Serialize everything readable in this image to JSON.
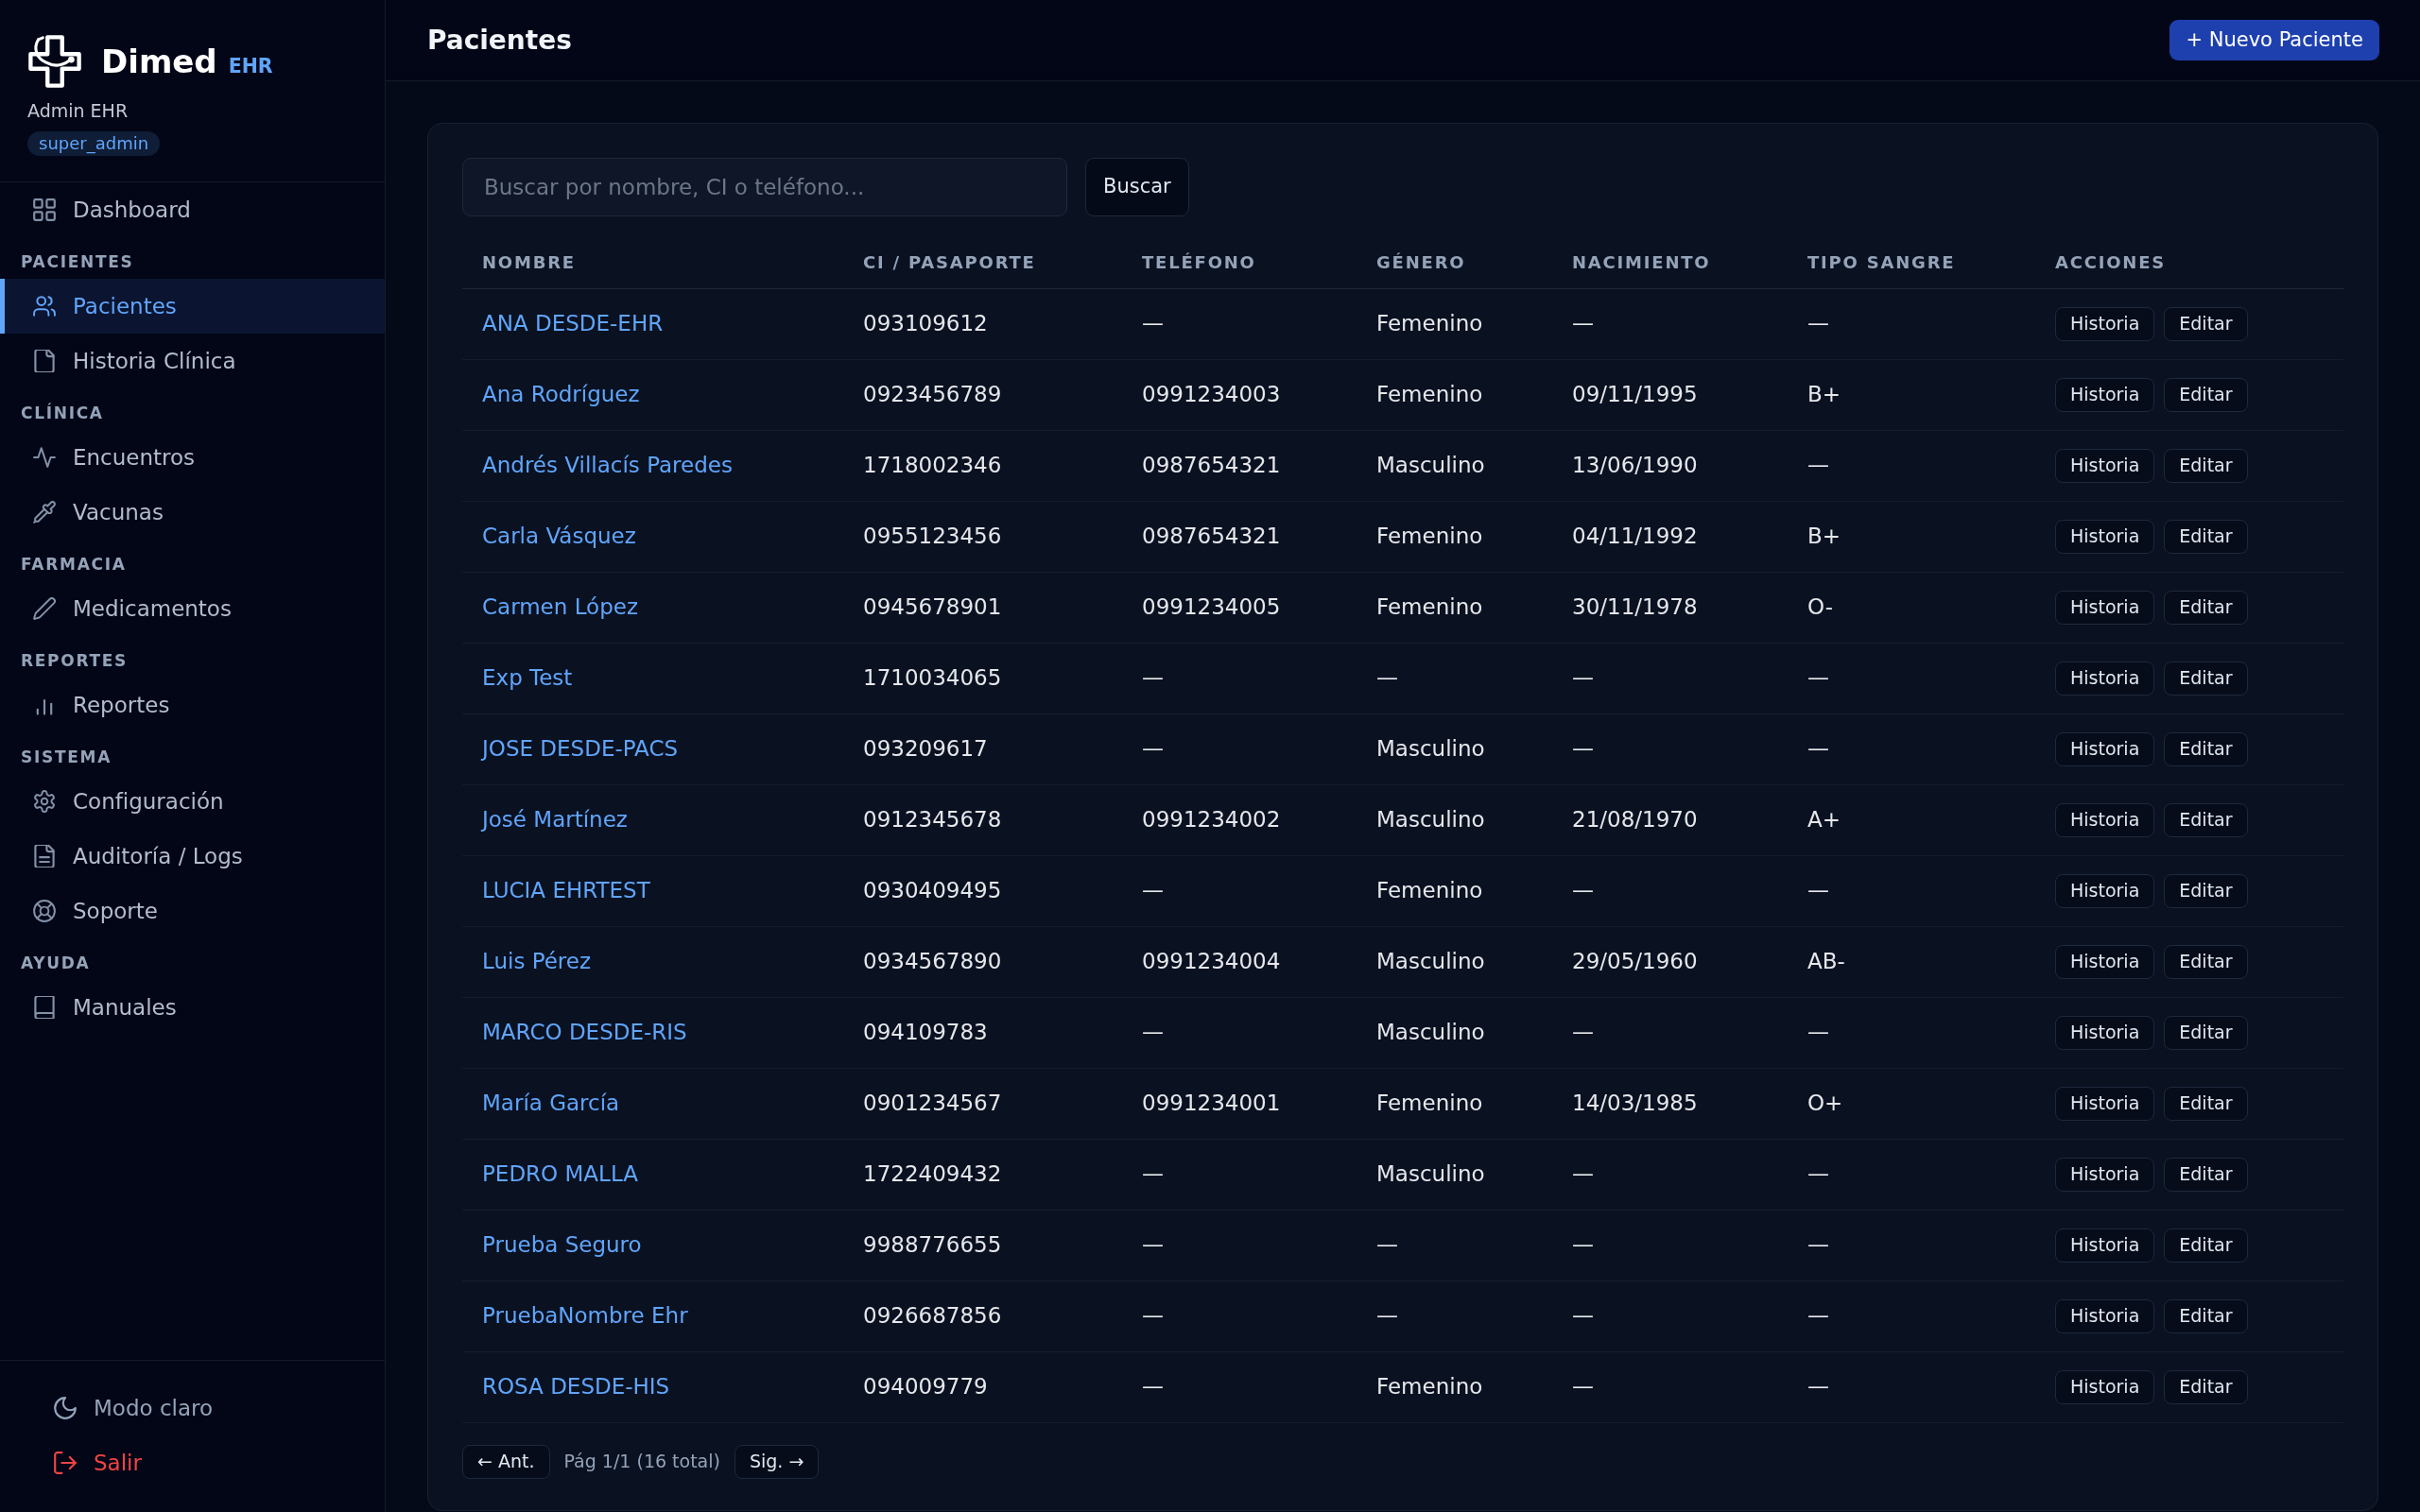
{
  "sidebar": {
    "brand": {
      "name": "Dimed",
      "suffix": "EHR"
    },
    "user": {
      "name": "Admin EHR",
      "role": "super_admin"
    },
    "sections": [
      {
        "items": [
          {
            "label": "Dashboard",
            "selected": false
          }
        ]
      },
      {
        "title": "PACIENTES",
        "items": [
          {
            "label": "Pacientes",
            "selected": true
          },
          {
            "label": "Historia Clínica",
            "selected": false
          }
        ]
      },
      {
        "title": "CLÍNICA",
        "items": [
          {
            "label": "Encuentros",
            "selected": false
          },
          {
            "label": "Vacunas",
            "selected": false
          }
        ]
      },
      {
        "title": "FARMACIA",
        "items": [
          {
            "label": "Medicamentos",
            "selected": false
          }
        ]
      },
      {
        "title": "REPORTES",
        "items": [
          {
            "label": "Reportes",
            "selected": false
          }
        ]
      },
      {
        "title": "SISTEMA",
        "items": [
          {
            "label": "Configuración",
            "selected": false
          },
          {
            "label": "Auditoría / Logs",
            "selected": false
          },
          {
            "label": "Soporte",
            "selected": false
          }
        ]
      },
      {
        "title": "AYUDA",
        "items": [
          {
            "label": "Manuales",
            "selected": false
          }
        ]
      }
    ],
    "footer": [
      {
        "kind": "theme",
        "label": "Modo claro"
      },
      {
        "kind": "logout",
        "label": "Salir"
      }
    ]
  },
  "header": {
    "title": "Pacientes",
    "new_button": "+ Nuevo Paciente"
  },
  "search": {
    "placeholder": "Buscar por nombre, CI o teléfono...",
    "button": "Buscar"
  },
  "table": {
    "columns": [
      "NOMBRE",
      "CI / PASAPORTE",
      "TELÉFONO",
      "GÉNERO",
      "NACIMIENTO",
      "TIPO SANGRE",
      "ACCIONES"
    ],
    "rows": [
      {
        "name": "ANA DESDE-EHR",
        "id_number": "093109612",
        "phone": "—",
        "gender": "Femenino",
        "birth_date": "—",
        "blood_type": "—",
        "actions": [
          "Historia",
          "Editar"
        ]
      },
      {
        "name": "Ana Rodríguez",
        "id_number": "0923456789",
        "phone": "0991234003",
        "gender": "Femenino",
        "birth_date": "09/11/1995",
        "blood_type": "B+",
        "actions": [
          "Historia",
          "Editar"
        ]
      },
      {
        "name": "Andrés Villacís Paredes",
        "id_number": "1718002346",
        "phone": "0987654321",
        "gender": "Masculino",
        "birth_date": "13/06/1990",
        "blood_type": "—",
        "actions": [
          "Historia",
          "Editar"
        ]
      },
      {
        "name": "Carla Vásquez",
        "id_number": "0955123456",
        "phone": "0987654321",
        "gender": "Femenino",
        "birth_date": "04/11/1992",
        "blood_type": "B+",
        "actions": [
          "Historia",
          "Editar"
        ]
      },
      {
        "name": "Carmen López",
        "id_number": "0945678901",
        "phone": "0991234005",
        "gender": "Femenino",
        "birth_date": "30/11/1978",
        "blood_type": "O-",
        "actions": [
          "Historia",
          "Editar"
        ]
      },
      {
        "name": "Exp Test",
        "id_number": "1710034065",
        "phone": "—",
        "gender": "—",
        "birth_date": "—",
        "blood_type": "—",
        "actions": [
          "Historia",
          "Editar"
        ]
      },
      {
        "name": "JOSE DESDE-PACS",
        "id_number": "093209617",
        "phone": "—",
        "gender": "Masculino",
        "birth_date": "—",
        "blood_type": "—",
        "actions": [
          "Historia",
          "Editar"
        ]
      },
      {
        "name": "José Martínez",
        "id_number": "0912345678",
        "phone": "0991234002",
        "gender": "Masculino",
        "birth_date": "21/08/1970",
        "blood_type": "A+",
        "actions": [
          "Historia",
          "Editar"
        ]
      },
      {
        "name": "LUCIA EHRTEST",
        "id_number": "0930409495",
        "phone": "—",
        "gender": "Femenino",
        "birth_date": "—",
        "blood_type": "—",
        "actions": [
          "Historia",
          "Editar"
        ]
      },
      {
        "name": "Luis Pérez",
        "id_number": "0934567890",
        "phone": "0991234004",
        "gender": "Masculino",
        "birth_date": "29/05/1960",
        "blood_type": "AB-",
        "actions": [
          "Historia",
          "Editar"
        ]
      },
      {
        "name": "MARCO DESDE-RIS",
        "id_number": "094109783",
        "phone": "—",
        "gender": "Masculino",
        "birth_date": "—",
        "blood_type": "—",
        "actions": [
          "Historia",
          "Editar"
        ]
      },
      {
        "name": "María García",
        "id_number": "0901234567",
        "phone": "0991234001",
        "gender": "Femenino",
        "birth_date": "14/03/1985",
        "blood_type": "O+",
        "actions": [
          "Historia",
          "Editar"
        ]
      },
      {
        "name": "PEDRO MALLA",
        "id_number": "1722409432",
        "phone": "—",
        "gender": "Masculino",
        "birth_date": "—",
        "blood_type": "—",
        "actions": [
          "Historia",
          "Editar"
        ]
      },
      {
        "name": "Prueba Seguro",
        "id_number": "9988776655",
        "phone": "—",
        "gender": "—",
        "birth_date": "—",
        "blood_type": "—",
        "actions": [
          "Historia",
          "Editar"
        ]
      },
      {
        "name": "PruebaNombre Ehr",
        "id_number": "0926687856",
        "phone": "—",
        "gender": "—",
        "birth_date": "—",
        "blood_type": "—",
        "actions": [
          "Historia",
          "Editar"
        ]
      },
      {
        "name": "ROSA DESDE-HIS",
        "id_number": "094009779",
        "phone": "—",
        "gender": "Femenino",
        "birth_date": "—",
        "blood_type": "—",
        "actions": [
          "Historia",
          "Editar"
        ]
      }
    ]
  },
  "pagination": {
    "previous": "← Ant.",
    "info": "Pág 1/1 (16 total)",
    "next": "Sig. →"
  }
}
